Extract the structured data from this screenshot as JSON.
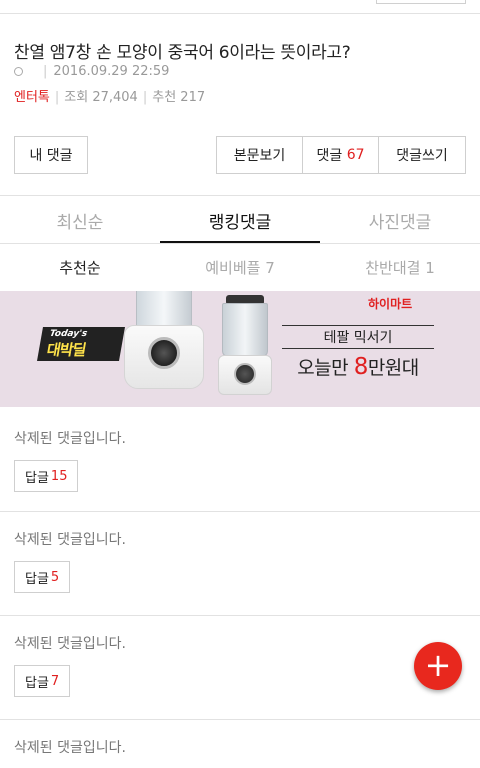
{
  "article": {
    "title": "찬열 앰7창 손 모양이 중국어 6이라는 뜻이라고?",
    "date": "2016.09.29 22:59",
    "category": "엔터톡",
    "views_label": "조회",
    "views": "27,404",
    "likes_label": "추천",
    "likes": "217"
  },
  "buttons": {
    "my_comment": "내 댓글",
    "view_article": "본문보기",
    "comments_label": "댓글",
    "comments_count": "67",
    "write_comment": "댓글쓰기"
  },
  "tabs": [
    {
      "label": "최신순"
    },
    {
      "label": "랭킹댓글"
    },
    {
      "label": "사진댓글"
    }
  ],
  "subtabs": [
    {
      "label": "추천순"
    },
    {
      "label": "예비베플 7"
    },
    {
      "label": "찬반대결 1"
    }
  ],
  "banner": {
    "badge_top": "Today's",
    "badge_main": "대박딜",
    "shop": "하이마트",
    "line1": "테팔 믹서기",
    "line2_pre": "오늘만 ",
    "line2_highlight": "8",
    "line2_post": "만원대"
  },
  "comments": [
    {
      "text": "삭제된 댓글입니다.",
      "reply_label": "답글",
      "reply_count": "15"
    },
    {
      "text": "삭제된 댓글입니다.",
      "reply_label": "답글",
      "reply_count": "5"
    },
    {
      "text": "삭제된 댓글입니다.",
      "reply_label": "답글",
      "reply_count": "7"
    },
    {
      "text": "삭제된 댓글입니다."
    }
  ],
  "fab": {
    "symbol": "+"
  },
  "colors": {
    "accent": "#e02020",
    "banner_bg": "#e9dde6",
    "fab": "#e8281e"
  }
}
